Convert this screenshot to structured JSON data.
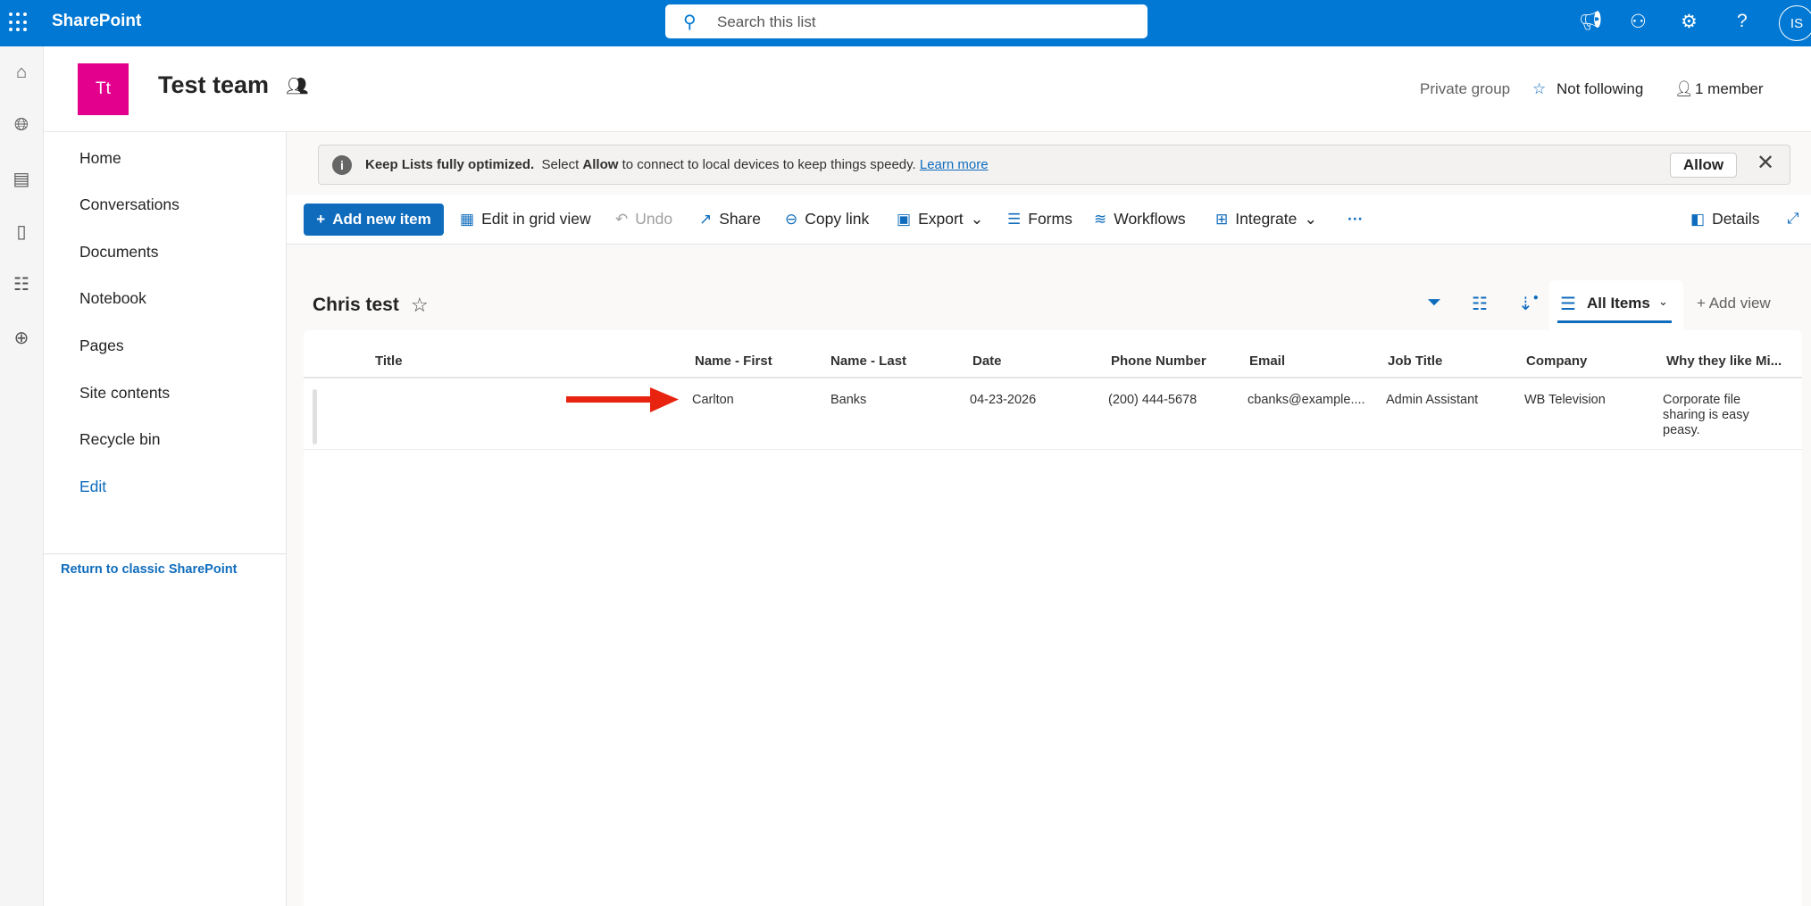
{
  "topbar": {
    "brand": "SharePoint",
    "search_placeholder": "Search this list",
    "avatar": "IS"
  },
  "site": {
    "logo": "Tt",
    "title": "Test team",
    "privacy": "Private group",
    "follow": "Not following",
    "members": "1 member"
  },
  "nav": {
    "items": [
      "Home",
      "Conversations",
      "Documents",
      "Notebook",
      "Pages",
      "Site contents",
      "Recycle bin",
      "Edit"
    ],
    "classic": "Return to classic SharePoint"
  },
  "notice": {
    "bold": "Keep Lists fully optimized.",
    "pre": "Select",
    "allow_word": "Allow",
    "post": "to connect to local devices to keep things speedy.",
    "link": "Learn more",
    "allow_button": "Allow"
  },
  "toolbar": {
    "add": "Add new item",
    "grid": "Edit in grid view",
    "undo": "Undo",
    "share": "Share",
    "copy": "Copy link",
    "export": "Export",
    "forms": "Forms",
    "workflows": "Workflows",
    "integrate": "Integrate",
    "more": "···",
    "details": "Details"
  },
  "list": {
    "title": "Chris test",
    "view": "All Items",
    "add_view": "Add view",
    "columns": [
      "Title",
      "Name - First",
      "Name - Last",
      "Date",
      "Phone Number",
      "Email",
      "Job Title",
      "Company",
      "Why they like Mi..."
    ],
    "rows": [
      {
        "title": "",
        "first": "Carlton",
        "last": "Banks",
        "date": "04-23-2026",
        "phone": "(200) 444-5678",
        "email": "cbanks@example....",
        "job": "Admin Assistant",
        "company": "WB Television",
        "why": "Corporate file sharing is easy peasy."
      }
    ]
  },
  "colors": {
    "brand": "#0078d4",
    "logo": "#e3008c",
    "arrow": "#e8230f"
  }
}
